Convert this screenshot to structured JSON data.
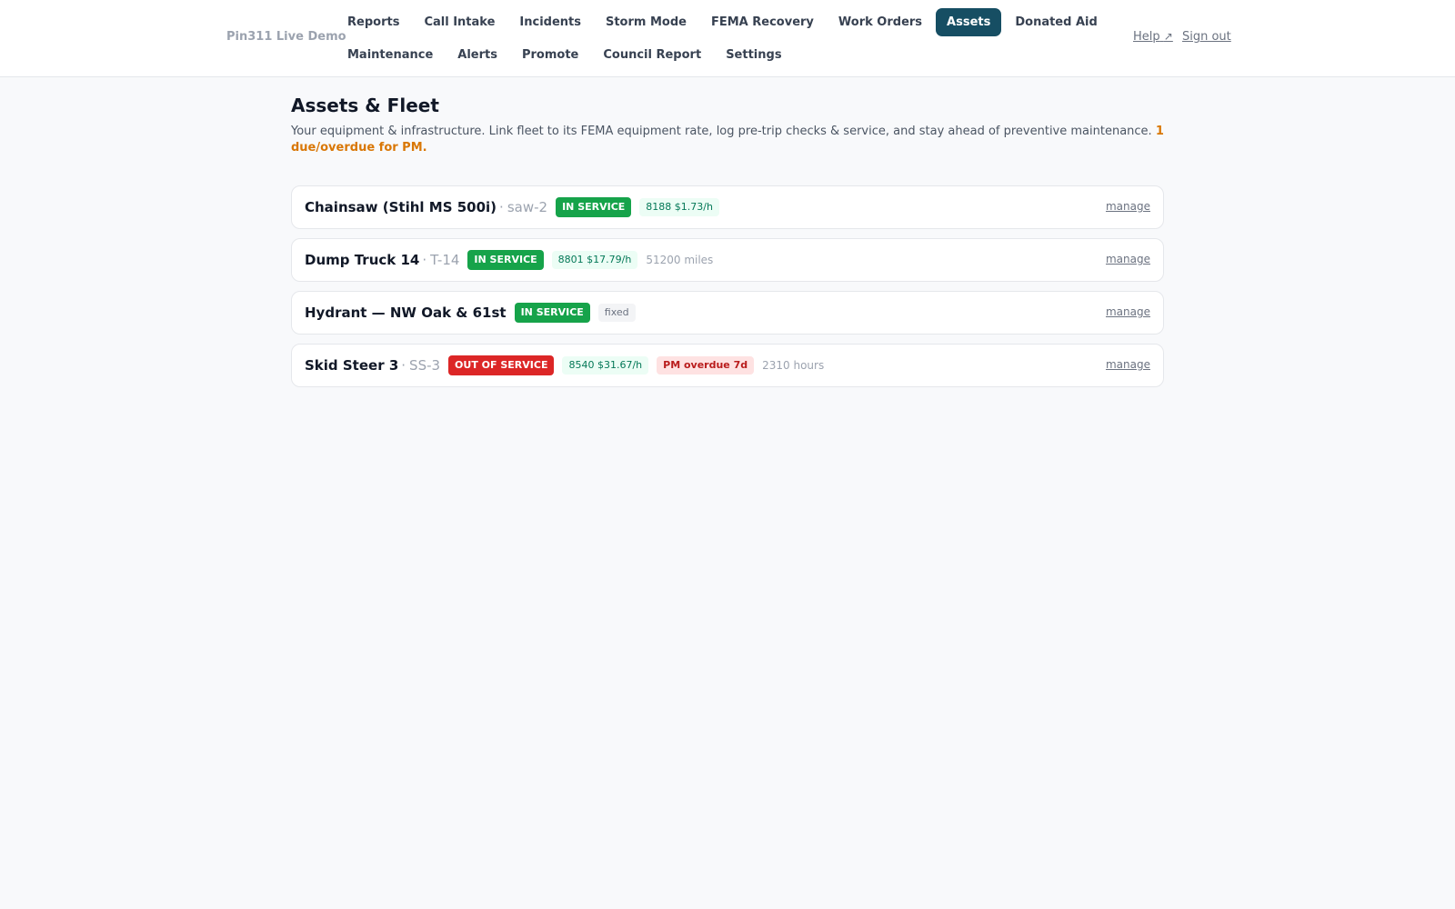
{
  "header": {
    "brand": "Pin311 Live Demo",
    "nav_row1": [
      "Reports",
      "Call Intake",
      "Incidents",
      "Storm Mode",
      "FEMA Recovery",
      "Work Orders",
      "Assets",
      "Donated Aid"
    ],
    "nav_row2": [
      "Maintenance",
      "Alerts",
      "Promote",
      "Council Report",
      "Settings"
    ],
    "active_nav": "Assets",
    "help_label": "Help",
    "help_icon": "↗",
    "signout_label": "Sign out"
  },
  "page": {
    "title": "Assets & Fleet",
    "intro": "Your equipment & infrastructure. Link fleet to its FEMA equipment rate, log pre-trip checks & service, and stay ahead of preventive maintenance.",
    "pm_warning": "1 due/overdue for PM."
  },
  "assets": [
    {
      "name": "Chainsaw (Stihl MS 500i)",
      "separator": "·",
      "code": "saw-2",
      "status": "IN SERVICE",
      "rate": "8188 $1.73/h",
      "pm": "",
      "meter": "",
      "tag": "",
      "manage": "manage"
    },
    {
      "name": "Dump Truck 14",
      "separator": "·",
      "code": "T-14",
      "status": "IN SERVICE",
      "rate": "8801 $17.79/h",
      "pm": "",
      "meter": "51200 miles",
      "tag": "",
      "manage": "manage"
    },
    {
      "name": "Hydrant — NW Oak & 61st",
      "separator": "",
      "code": "",
      "status": "IN SERVICE",
      "rate": "",
      "pm": "",
      "meter": "",
      "tag": "fixed",
      "manage": "manage"
    },
    {
      "name": "Skid Steer 3",
      "separator": "·",
      "code": "SS-3",
      "status": "OUT OF SERVICE",
      "rate": "8540 $31.67/h",
      "pm": "PM overdue 7d",
      "meter": "2310 hours",
      "tag": "",
      "manage": "manage"
    }
  ],
  "colors": {
    "active_nav": "#164e63",
    "in_service": "#16a34a",
    "out_of_service": "#dc2626",
    "warning": "#d97706"
  }
}
